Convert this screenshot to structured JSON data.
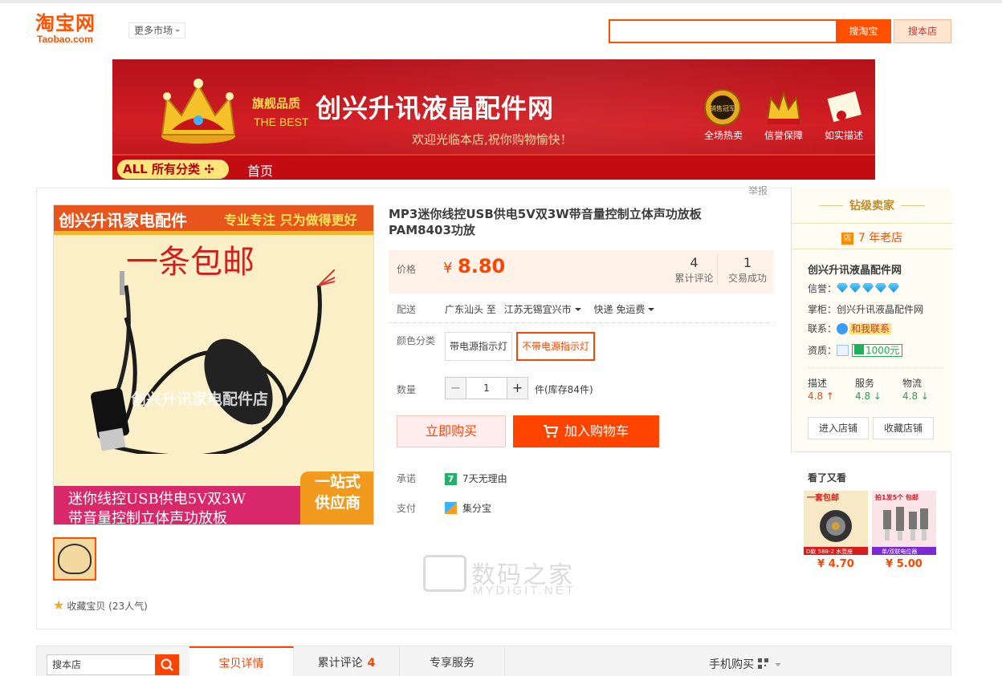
{
  "header": {
    "logo_cn": "淘宝网",
    "logo_en": "Taobao.com",
    "more_markets": "更多市场",
    "search_value": "",
    "search_taobao": "搜淘宝",
    "search_shop": "搜本店"
  },
  "banner": {
    "flagship": "旗舰品质",
    "the_best": "THE BEST",
    "title": "创兴升讯液晶配件网",
    "welcome": "欢迎光临本店,祝你购物愉快！",
    "badges": [
      "全场热卖",
      "信誉保障",
      "如实描述"
    ],
    "badge1_text": "销售冠军",
    "all_categories": "ALL 所有分类",
    "home": "首页"
  },
  "report": "举报",
  "gallery": {
    "top_brand": "创兴升讯家电配件",
    "top_slogan": "专业专注 只为做得更好",
    "free_shipping": "一条包邮",
    "watermark": "创兴升讯家电配件店",
    "bottom_line1": "迷你线控USB供电5V双3W",
    "bottom_line2": "带音量控制立体声功放板",
    "badge_line1": "一站式",
    "badge_line2": "供应商",
    "favorite": "收藏宝贝 (23人气)"
  },
  "product": {
    "title": "MP3迷你线控USB供电5V双3W带音量控制立体声功放板PAM8403功放",
    "price_label": "价格",
    "currency": "¥",
    "price": "8.80",
    "reviews_count": "4",
    "reviews_label": "累计评论",
    "deals_count": "1",
    "deals_label": "交易成功",
    "ship_label": "配送",
    "ship_from": "广东汕头 至",
    "ship_to": "江苏无锡宜兴市",
    "ship_method": "快递 免运费",
    "color_label": "颜色分类",
    "color_options": [
      "带电源指示灯",
      "不带电源指示灯"
    ],
    "qty_label": "数量",
    "quantity": "1",
    "stock": "件(库存84件)",
    "buy_now": "立即购买",
    "add_cart": "加入购物车",
    "promise_label": "承诺",
    "promise_icon": "7",
    "promise": "7天无理由",
    "pay_label": "支付",
    "pay": "集分宝"
  },
  "watermark": {
    "cn": "数码之家",
    "en": "MYDIGIT.NET"
  },
  "seller": {
    "level": "钻级卖家",
    "store_icon": "店",
    "years": "7 年老店",
    "shop_name": "创兴升讯液晶配件网",
    "credit_label": "信誉：",
    "diamonds": 5,
    "owner_label": "掌柜：",
    "owner": "创兴升讯液晶配件网",
    "contact_label": "联系：",
    "contact": "和我联系",
    "qual_label": "资质：",
    "deposit": "1000元",
    "scores": [
      {
        "label": "描述",
        "value": "4.8",
        "trend": "up"
      },
      {
        "label": "服务",
        "value": "4.8",
        "trend": "down"
      },
      {
        "label": "物流",
        "value": "4.8",
        "trend": "down"
      }
    ],
    "enter_shop": "进入店铺",
    "fav_shop": "收藏店铺"
  },
  "also_viewed": {
    "title": "看了又看",
    "items": [
      {
        "price": "¥ 4.70",
        "tag_top": "一套包邮",
        "tag_bottom": "D款 588-2 水壶座"
      },
      {
        "price": "¥ 5.00",
        "tag_top": "拍1发5个 包邮",
        "tag_bottom": "单/双联电位器"
      }
    ]
  },
  "tabs": {
    "shop_search": "搜本店",
    "items": [
      "宝贝详情",
      "累计评论",
      "专享服务"
    ],
    "review_count": "4",
    "mobile_buy": "手机购买"
  },
  "colors": {
    "brand_orange": "#ff5000",
    "price_red": "#ff4400",
    "banner_red": "#c20c12"
  }
}
